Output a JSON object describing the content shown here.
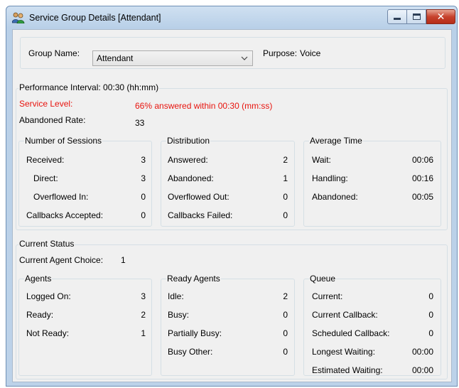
{
  "window": {
    "title": "Service Group Details [Attendant]",
    "controls": {
      "minimize": "minimize",
      "maximize": "maximize",
      "close": "close"
    }
  },
  "group": {
    "name_label": "Group Name:",
    "name_value": "Attendant",
    "purpose_label": "Purpose:",
    "purpose_value": "Voice"
  },
  "performance": {
    "title": "Performance Interval: 00:30 (hh:mm)",
    "service_level_label": "Service Level:",
    "service_level_value": "66% answered within 00:30 (mm:ss)",
    "abandoned_rate_label": "Abandoned Rate:",
    "abandoned_rate_value": "33",
    "sessions": {
      "title": "Number of Sessions",
      "rows": [
        {
          "label": "Received:",
          "value": "3"
        },
        {
          "label": "Direct:",
          "value": "3"
        },
        {
          "label": "Overflowed In:",
          "value": "0"
        },
        {
          "label": "Callbacks Accepted:",
          "value": "0"
        }
      ]
    },
    "distribution": {
      "title": "Distribution",
      "rows": [
        {
          "label": "Answered:",
          "value": "2"
        },
        {
          "label": "Abandoned:",
          "value": "1"
        },
        {
          "label": "Overflowed Out:",
          "value": "0"
        },
        {
          "label": "Callbacks Failed:",
          "value": "0"
        }
      ]
    },
    "average_time": {
      "title": "Average Time",
      "rows": [
        {
          "label": "Wait:",
          "value": "00:06"
        },
        {
          "label": "Handling:",
          "value": "00:16"
        },
        {
          "label": "Abandoned:",
          "value": "00:05"
        }
      ]
    }
  },
  "status": {
    "title": "Current Status",
    "agent_choice_label": "Current Agent Choice:",
    "agent_choice_value": "1",
    "agents": {
      "title": "Agents",
      "rows": [
        {
          "label": "Logged On:",
          "value": "3"
        },
        {
          "label": "Ready:",
          "value": "2"
        },
        {
          "label": "Not Ready:",
          "value": "1"
        }
      ]
    },
    "ready_agents": {
      "title": "Ready Agents",
      "rows": [
        {
          "label": "Idle:",
          "value": "2"
        },
        {
          "label": "Busy:",
          "value": "0"
        },
        {
          "label": "Partially Busy:",
          "value": "0"
        },
        {
          "label": "Busy Other:",
          "value": "0"
        }
      ]
    },
    "queue": {
      "title": "Queue",
      "rows": [
        {
          "label": "Current:",
          "value": "0"
        },
        {
          "label": "Current Callback:",
          "value": "0"
        },
        {
          "label": "Scheduled Callback:",
          "value": "0"
        },
        {
          "label": "Longest Waiting:",
          "value": "00:00"
        },
        {
          "label": "Estimated Waiting:",
          "value": "00:00"
        }
      ]
    }
  },
  "colors": {
    "service_level": "#e8140e",
    "close_button": "#c7422d",
    "window_frame": "#b9d0e8"
  }
}
